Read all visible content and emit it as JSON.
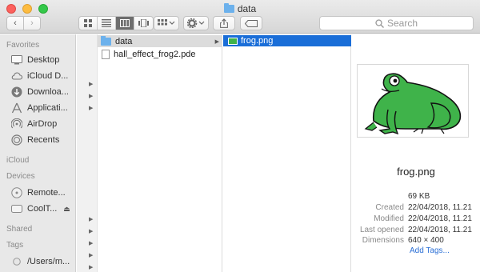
{
  "window": {
    "title": "data"
  },
  "toolbar": {
    "back_glyph": "‹",
    "forward_glyph": "›",
    "view_modes": [
      "icon-view",
      "list-view",
      "column-view",
      "cover-flow-view"
    ],
    "active_view": "column-view",
    "search_placeholder": "Search"
  },
  "sidebar": {
    "sections": [
      {
        "label": "Favorites",
        "items": [
          {
            "label": "Desktop",
            "icon": "desktop-icon"
          },
          {
            "label": "iCloud D...",
            "icon": "cloud-icon"
          },
          {
            "label": "Downloa...",
            "icon": "download-icon"
          },
          {
            "label": "Applicati...",
            "icon": "applications-icon"
          },
          {
            "label": "AirDrop",
            "icon": "airdrop-icon"
          },
          {
            "label": "Recents",
            "icon": "recents-icon"
          }
        ]
      },
      {
        "label": "iCloud",
        "items": []
      },
      {
        "label": "Devices",
        "items": [
          {
            "label": "Remote...",
            "icon": "disc-icon"
          },
          {
            "label": "CoolT...",
            "icon": "drive-icon"
          }
        ]
      },
      {
        "label": "Shared",
        "items": []
      },
      {
        "label": "Tags",
        "items": [
          {
            "label": "/Users/m...",
            "icon": "tag-icon"
          }
        ]
      }
    ]
  },
  "column1": {
    "items": [
      {
        "name": "data",
        "type": "folder",
        "selected": true
      },
      {
        "name": "hall_effect_frog2.pde",
        "type": "document",
        "selected": false
      }
    ]
  },
  "column2": {
    "items": [
      {
        "name": "frog.png",
        "type": "image",
        "selected": true
      }
    ]
  },
  "preview": {
    "name": "frog.png",
    "size": "69 KB",
    "created_label": "Created",
    "created": "22/04/2018, 11.21",
    "modified_label": "Modified",
    "modified": "22/04/2018, 11.21",
    "last_opened_label": "Last opened",
    "last_opened": "22/04/2018, 11.21",
    "dimensions_label": "Dimensions",
    "dimensions": "640 × 400",
    "add_tags": "Add Tags..."
  },
  "colors": {
    "selection": "#1a6ed8",
    "folder": "#6cb1ec",
    "frog": "#3fb34a"
  }
}
